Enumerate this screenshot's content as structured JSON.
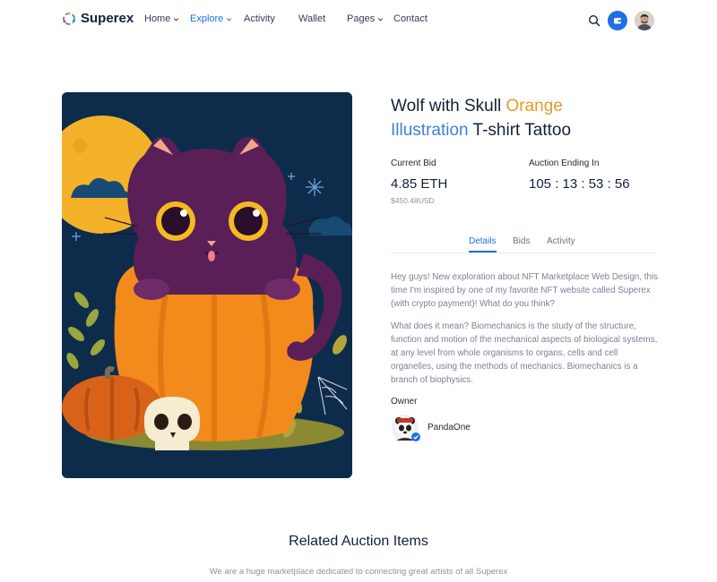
{
  "header": {
    "brand": "Superex",
    "nav": [
      {
        "label": "Home",
        "has_dropdown": true,
        "active": false
      },
      {
        "label": "Explore",
        "has_dropdown": true,
        "active": true
      },
      {
        "label": "Activity",
        "has_dropdown": false,
        "active": false
      },
      {
        "label": "Wallet",
        "has_dropdown": false,
        "active": false
      },
      {
        "label": "Pages",
        "has_dropdown": true,
        "active": false
      },
      {
        "label": "Contact",
        "has_dropdown": false,
        "active": false
      }
    ],
    "icons": {
      "search": "search-icon",
      "wallet": "wallet-icon",
      "avatar": "user-avatar"
    }
  },
  "item": {
    "title_parts": [
      "Wolf with Skull ",
      "Orange",
      "Illustration",
      " T-shirt Tattoo"
    ],
    "bid": {
      "label": "Current Bid",
      "value": "4.85 ETH",
      "usd": "$450.48USD"
    },
    "auction": {
      "label": "Auction Ending In",
      "value": "105 : 13 : 53 : 56"
    },
    "tabs": [
      "Details",
      "Bids",
      "Activity"
    ],
    "active_tab": "Details",
    "description": [
      "Hey guys! New exploration about NFT Marketplace Web Design, this time I'm inspired by one of my favorite NFT website called Superex (with crypto payment)! What do you think?",
      "What does it mean? Biomechanics is the study of the structure, function and motion of the mechanical aspects of biological systems, at any level from whole organisms to organs, cells and cell organelles, using the methods of mechanics. Biomechanics is a branch of biophysics."
    ],
    "owner": {
      "label": "Owner",
      "name": "PandaOne",
      "verified": true
    }
  },
  "related": {
    "title": "Related Auction Items",
    "subtitle": "We are a huge marketplace dedicated to connecting great artists of all Superex"
  },
  "colors": {
    "accent": "#1f6fe5",
    "title_orange": "#e39a28",
    "title_blue": "#3d7fd8",
    "art_bg": "#0d2c4c"
  }
}
